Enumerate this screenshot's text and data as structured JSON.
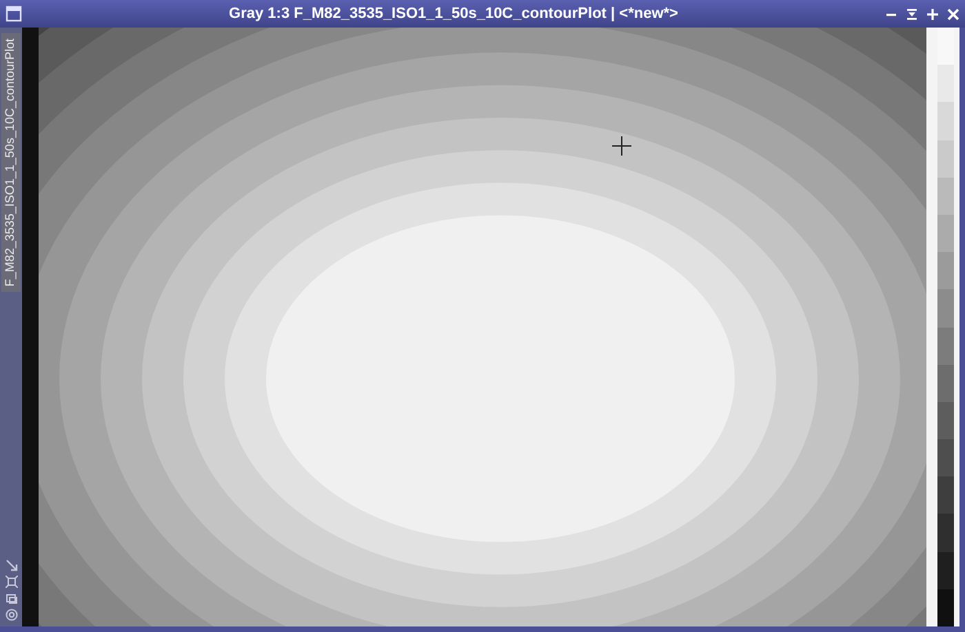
{
  "window": {
    "title": "Gray 1:3 F_M82_3535_ISO1_1_50s_10C_contourPlot | <*new*>"
  },
  "side_tab": {
    "label": "F_M82_3535_ISO1_1_50s_10C_contourPlot"
  }
}
